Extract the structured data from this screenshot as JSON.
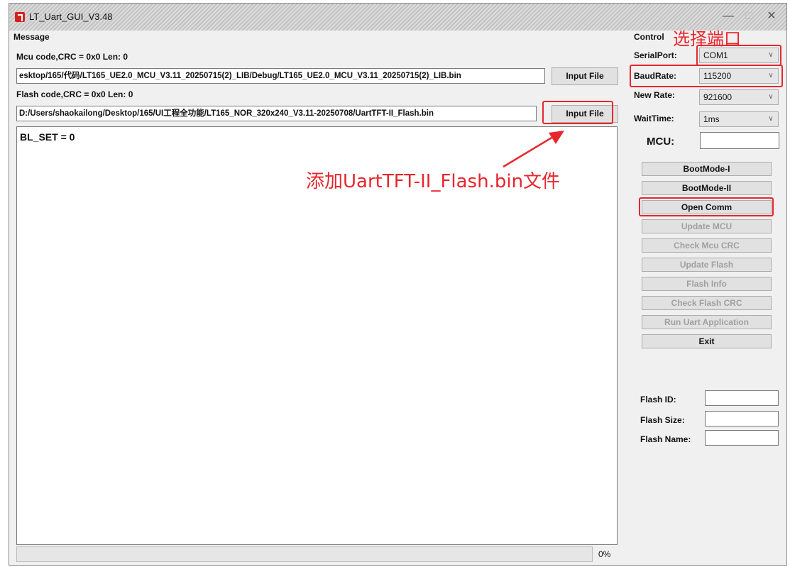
{
  "window": {
    "title": "LT_Uart_GUI_V3.48",
    "minimize_glyph": "—",
    "maximize_glyph": "☐",
    "close_glyph": "✕"
  },
  "message": {
    "section_label": "Message",
    "mcu_code_label": "Mcu code,CRC = 0x0  Len: 0",
    "mcu_path": "esktop/165/代码/LT165_UE2.0_MCU_V3.11_20250715(2)_LIB/Debug/LT165_UE2.0_MCU_V3.11_20250715(2)_LIB.bin",
    "mcu_input_button": "Input File",
    "flash_code_label": "Flash code,CRC = 0x0  Len: 0",
    "flash_path": "D:/Users/shaokailong/Desktop/165/UI工程全功能/LT165_NOR_320x240_V3.11-20250708/UartTFT-II_Flash.bin",
    "flash_input_button": "Input File",
    "log_text": "BL_SET = 0",
    "progress": 0,
    "progress_text": "0%"
  },
  "control": {
    "section_label": "Control",
    "serial_port_label": "SerialPort:",
    "serial_port_value": "COM1",
    "baud_rate_label": "BaudRate:",
    "baud_rate_value": "115200",
    "new_rate_label": "New Rate:",
    "new_rate_value": "921600",
    "wait_time_label": "WaitTime:",
    "wait_time_value": "1ms",
    "mcu_label": "MCU:",
    "mcu_value": "",
    "buttons": [
      {
        "label": "BootMode-I",
        "enabled": true
      },
      {
        "label": "BootMode-II",
        "enabled": true
      },
      {
        "label": "Open Comm",
        "enabled": true
      },
      {
        "label": "Update MCU",
        "enabled": false
      },
      {
        "label": "Check Mcu CRC",
        "enabled": false
      },
      {
        "label": "Update Flash",
        "enabled": false
      },
      {
        "label": "Flash Info",
        "enabled": false
      },
      {
        "label": "Check Flash CRC",
        "enabled": false
      },
      {
        "label": "Run Uart Application",
        "enabled": false
      },
      {
        "label": "Exit",
        "enabled": true
      }
    ],
    "flash_id_label": "Flash ID:",
    "flash_id_value": "",
    "flash_size_label": "Flash Size:",
    "flash_size_value": "",
    "flash_name_label": "Flash Name:",
    "flash_name_value": ""
  },
  "annotations": {
    "select_port": "选择端口",
    "add_flash_bin": "添加UartTFT-II_Flash.bin文件",
    "color": "#e8262d"
  }
}
